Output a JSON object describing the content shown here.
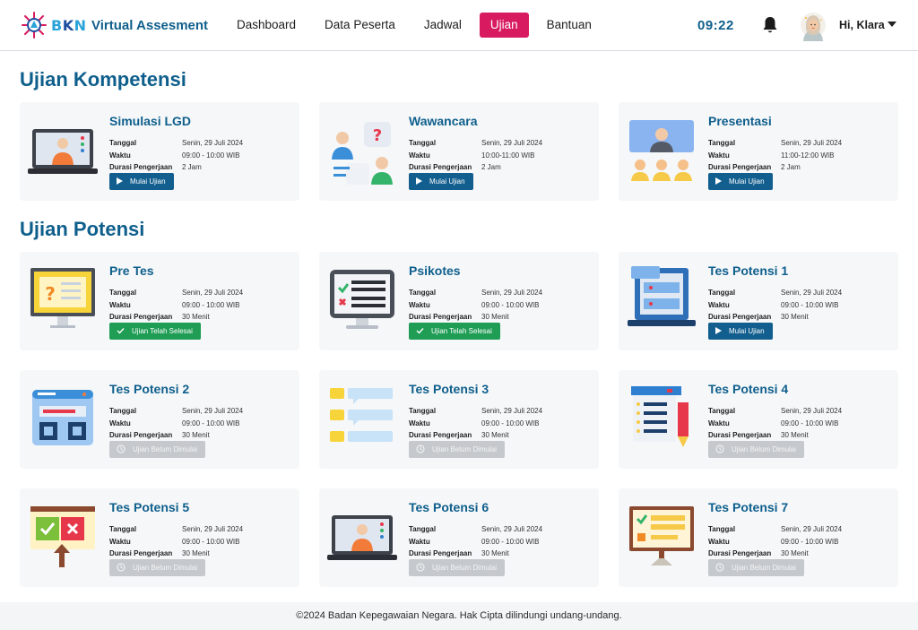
{
  "header": {
    "logo_text_a": "B",
    "logo_text_b": "K",
    "logo_text_c": "N",
    "app_title": "Virtual Assesment",
    "nav": [
      {
        "label": "Dashboard",
        "active": false
      },
      {
        "label": "Data Peserta",
        "active": false
      },
      {
        "label": "Jadwal",
        "active": false
      },
      {
        "label": "Ujian",
        "active": true
      },
      {
        "label": "Bantuan",
        "active": false
      }
    ],
    "clock": "09:22",
    "greeting": "Hi, Klara"
  },
  "labels": {
    "tanggal": "Tanggal",
    "waktu": "Waktu",
    "durasi": "Durasi Pengerjaan"
  },
  "sections": {
    "kompetensi_title": "Ujian Kompetensi",
    "potensi_title": "Ujian Potensi"
  },
  "kompetensi": [
    {
      "title": "Simulasi LGD",
      "tanggal": "Senin, 29 Juli 2024",
      "waktu": "09:00 - 10:00 WIB",
      "durasi": "2 Jam",
      "button": "Mulai Ujian",
      "status": "start",
      "icon": "laptop-video-call-icon"
    },
    {
      "title": "Wawancara",
      "tanggal": "Senin, 29 Juli 2024",
      "waktu": "10:00-11:00 WIB",
      "durasi": "2 Jam",
      "button": "Mulai Ujian",
      "status": "start",
      "icon": "interview-icon"
    },
    {
      "title": "Presentasi",
      "tanggal": "Senin, 29 Juli 2024",
      "waktu": "11:00-12:00 WIB",
      "durasi": "2 Jam",
      "button": "Mulai Ujian",
      "status": "start",
      "icon": "presentation-audience-icon"
    }
  ],
  "potensi": [
    {
      "title": "Pre Tes",
      "tanggal": "Senin, 29 Juli 2024",
      "waktu": "09:00 - 10:00 WIB",
      "durasi": "30 Menit",
      "button": "Ujian Telah Selesai",
      "status": "done",
      "icon": "monitor-question-icon"
    },
    {
      "title": "Psikotes",
      "tanggal": "Senin, 29 Juli 2024",
      "waktu": "09:00 - 10:00 WIB",
      "durasi": "30 Menit",
      "button": "Ujian Telah Selesai",
      "status": "done",
      "icon": "monitor-checklist-icon"
    },
    {
      "title": "Tes Potensi 1",
      "tanggal": "Senin, 29 Juli 2024",
      "waktu": "09:00 - 10:00 WIB",
      "durasi": "30 Menit",
      "button": "Mulai Ujian",
      "status": "start",
      "icon": "laptop-form-icon"
    },
    {
      "title": "Tes Potensi 2",
      "tanggal": "Senin, 29 Juli 2024",
      "waktu": "09:00 - 10:00 WIB",
      "durasi": "30 Menit",
      "button": "Ujian Belum Dimulai",
      "status": "wait",
      "icon": "browser-window-icon"
    },
    {
      "title": "Tes Potensi 3",
      "tanggal": "Senin, 29 Juli 2024",
      "waktu": "09:00 - 10:00 WIB",
      "durasi": "30 Menit",
      "button": "Ujian Belum Dimulai",
      "status": "wait",
      "icon": "list-items-icon"
    },
    {
      "title": "Tes Potensi 4",
      "tanggal": "Senin, 29 Juli 2024",
      "waktu": "09:00 - 10:00 WIB",
      "durasi": "30 Menit",
      "button": "Ujian Belum Dimulai",
      "status": "wait",
      "icon": "document-pencil-icon"
    },
    {
      "title": "Tes Potensi 5",
      "tanggal": "Senin, 29 Juli 2024",
      "waktu": "09:00 - 10:00 WIB",
      "durasi": "30 Menit",
      "button": "Ujian Belum Dimulai",
      "status": "wait",
      "icon": "true-false-board-icon"
    },
    {
      "title": "Tes Potensi 6",
      "tanggal": "Senin, 29 Juli 2024",
      "waktu": "09:00 - 10:00 WIB",
      "durasi": "30 Menit",
      "button": "Ujian Belum Dimulai",
      "status": "wait",
      "icon": "laptop-video-call-icon"
    },
    {
      "title": "Tes Potensi 7",
      "tanggal": "Senin, 29 Juli 2024",
      "waktu": "09:00 - 10:00 WIB",
      "durasi": "30 Menit",
      "button": "Ujian Belum Dimulai",
      "status": "wait",
      "icon": "board-checklist-icon"
    }
  ],
  "footer": {
    "text": "©2024 Badan Kepegawaian Negara. Hak Cipta dilindungi undang-undang."
  },
  "colors": {
    "primary": "#0f5f8c",
    "accent": "#d81b60",
    "done": "#1f9d55",
    "disabled": "#c5c9cd",
    "card_bg": "#f5f7f9"
  }
}
